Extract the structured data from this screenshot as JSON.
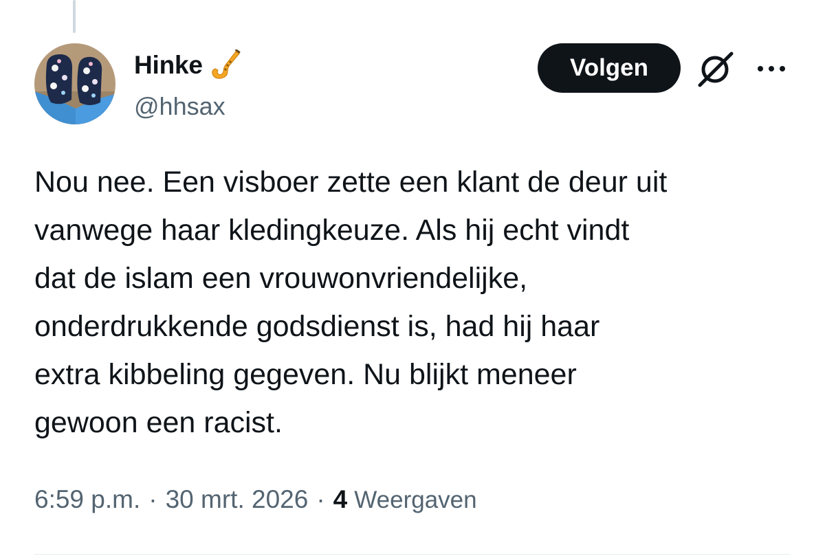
{
  "author": {
    "display_name": "Hinke",
    "badge_icon": "saxophone-icon",
    "handle": "@hhsax"
  },
  "actions": {
    "follow_label": "Volgen",
    "grok_icon": "grok-icon",
    "more_icon": "more-options-icon"
  },
  "tweet": {
    "text": "Nou nee. Een visboer zette een klant de deur uit\nvanwege haar kledingkeuze. Als hij echt vindt\ndat de islam een vrouwonvriendelijke,\nonderdrukkende godsdienst is, had hij haar\nextra kibbeling gegeven. Nu blijkt meneer\ngewoon een racist."
  },
  "meta": {
    "time": "6:59 p.m.",
    "separator": "·",
    "date": "30 mrt. 2026",
    "views_count": "4",
    "views_label": "Weergaven"
  },
  "colors": {
    "text_primary": "#0f1419",
    "text_secondary": "#536471",
    "button_bg": "#0f1419",
    "saxophone": "#f5a623"
  }
}
